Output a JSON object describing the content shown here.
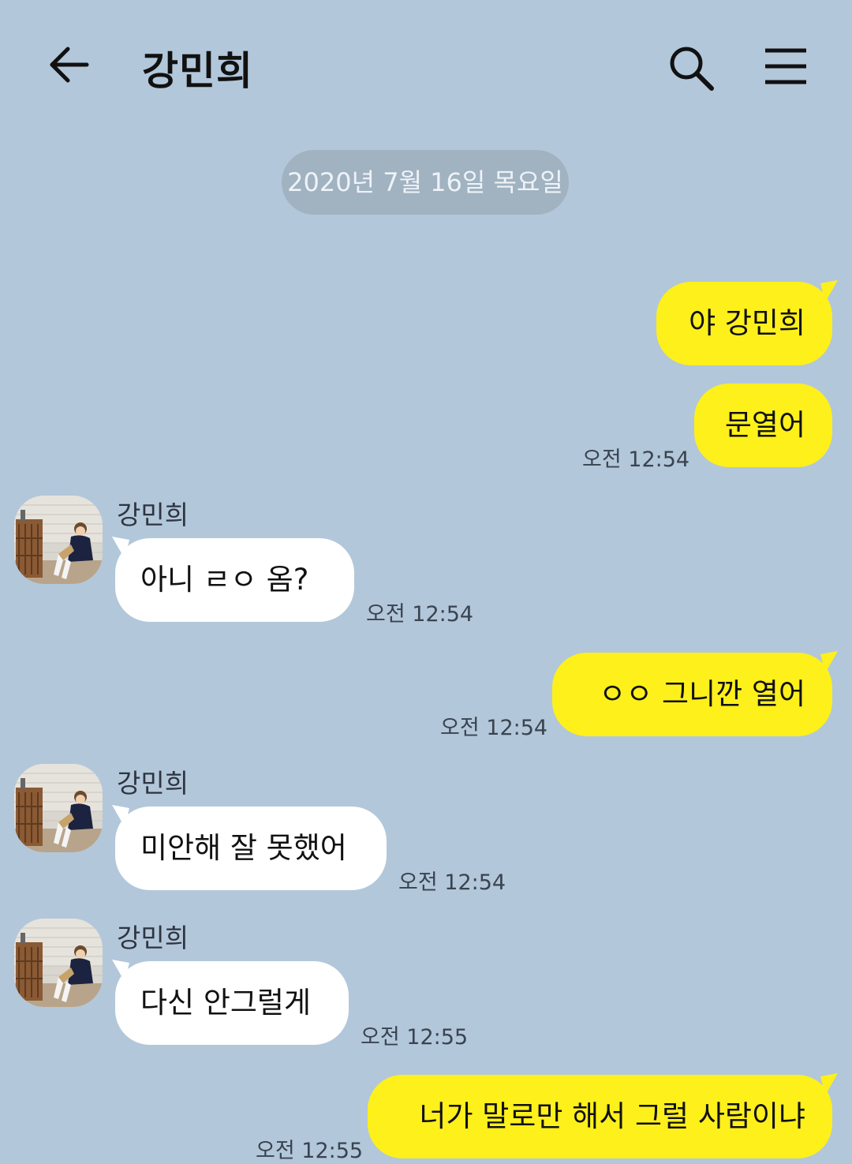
{
  "header": {
    "title": "강민희",
    "back_icon": "arrow-left-icon",
    "search_icon": "search-icon",
    "menu_icon": "hamburger-menu-icon"
  },
  "date_divider": "2020년 7월 16일 목요일",
  "colors": {
    "background": "#b2c7da",
    "my_bubble": "#fef01b",
    "their_bubble": "#ffffff",
    "date_pill": "#a1b2c1"
  },
  "messages": [
    {
      "from": "me",
      "text": "야 강민희"
    },
    {
      "from": "me",
      "text": "문열어",
      "time": "오전 12:54"
    },
    {
      "from": "them",
      "sender": "강민희",
      "text": "아니 ㄹㅇ 옴?",
      "time": "오전 12:54"
    },
    {
      "from": "me",
      "text": "ㅇㅇ 그니깐 열어",
      "time": "오전 12:54"
    },
    {
      "from": "them",
      "sender": "강민희",
      "text": "미안해 잘 못했어",
      "time": "오전 12:54"
    },
    {
      "from": "them",
      "sender": "강민희",
      "text": "다신 안그럴게",
      "time": "오전 12:55"
    },
    {
      "from": "me",
      "text": "너가 말로만 해서 그럴 사람이냐",
      "time": "오전 12:55"
    }
  ]
}
